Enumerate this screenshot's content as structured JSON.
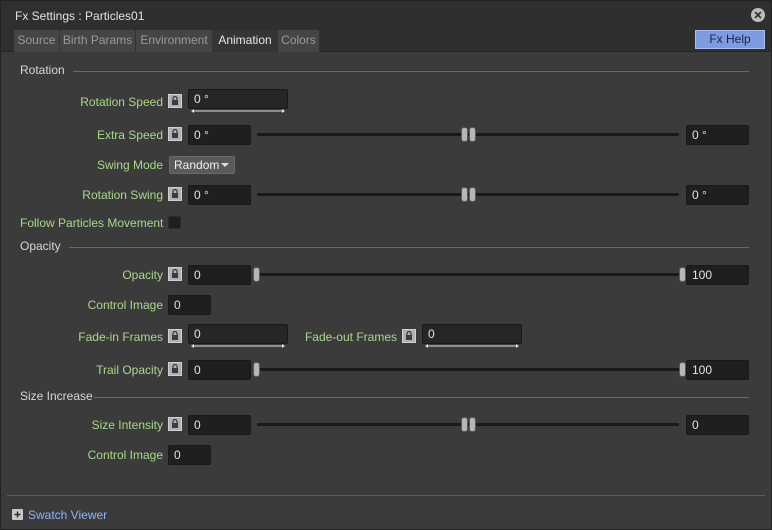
{
  "window": {
    "title": "Fx Settings : Particles01"
  },
  "tabs": [
    "Source",
    "Birth Params",
    "Environment",
    "Animation",
    "Colors"
  ],
  "active_tab": "Animation",
  "help_button": "Fx Help",
  "sections": {
    "rotation": {
      "title": "Rotation",
      "rotation_speed": {
        "label": "Rotation Speed",
        "value": "0 °"
      },
      "extra_speed": {
        "label": "Extra Speed",
        "min": "0 °",
        "max": "0 °"
      },
      "swing_mode": {
        "label": "Swing Mode",
        "value": "Random"
      },
      "rotation_swing": {
        "label": "Rotation Swing",
        "min": "0 °",
        "max": "0 °"
      },
      "follow_movement": {
        "label": "Follow Particles Movement",
        "checked": false
      }
    },
    "opacity": {
      "title": "Opacity",
      "opacity": {
        "label": "Opacity",
        "min": "0",
        "max": "100"
      },
      "control_image": {
        "label": "Control Image",
        "value": "0"
      },
      "fade_in": {
        "label": "Fade-in Frames",
        "value": "0"
      },
      "fade_out": {
        "label": "Fade-out Frames",
        "value": "0"
      },
      "trail_opacity": {
        "label": "Trail Opacity",
        "min": "0",
        "max": "100"
      }
    },
    "size_increase": {
      "title": "Size Increase",
      "size_intensity": {
        "label": "Size Intensity",
        "min": "0",
        "max": "0"
      },
      "control_image": {
        "label": "Control Image",
        "value": "0"
      }
    }
  },
  "footer": {
    "swatch_viewer": "Swatch Viewer"
  },
  "icons": {
    "lock": "lock-icon",
    "close": "close-icon",
    "expand": "plus-expand-icon"
  },
  "colors": {
    "label_green": "#a9d88b",
    "accent_blue": "#7d9be0",
    "link_blue": "#8fb4ff"
  }
}
